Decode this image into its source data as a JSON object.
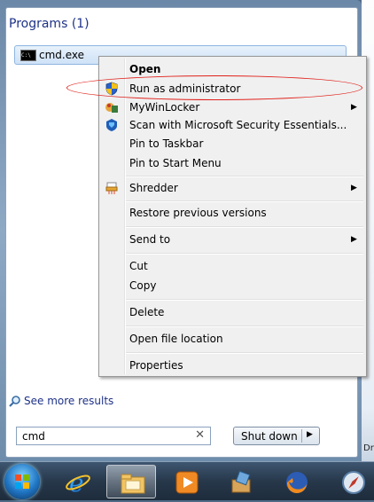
{
  "start_menu": {
    "programs_heading": "Programs (1)",
    "program_items": [
      {
        "label": "cmd.exe",
        "icon": "cmd-icon"
      }
    ],
    "see_more": "See more results",
    "search": {
      "value": "cmd"
    },
    "shutdown_label": "Shut down"
  },
  "context_menu": {
    "items": [
      {
        "label": "Open",
        "bold": true
      },
      {
        "label": "Run as administrator",
        "icon": "uac-shield-icon"
      },
      {
        "label": "MyWinLocker",
        "icon": "mywinlocker-icon",
        "submenu": true
      },
      {
        "label": "Scan with Microsoft Security Essentials...",
        "icon": "security-essentials-icon"
      },
      {
        "label": "Pin to Taskbar"
      },
      {
        "label": "Pin to Start Menu"
      },
      {
        "label": "Shredder",
        "icon": "shredder-icon",
        "submenu": true
      },
      {
        "label": "Restore previous versions"
      },
      {
        "label": "Send to",
        "submenu": true
      },
      {
        "label": "Cut"
      },
      {
        "label": "Copy"
      },
      {
        "label": "Delete"
      },
      {
        "label": "Open file location"
      },
      {
        "label": "Properties"
      }
    ],
    "highlighted_item": "Run as administrator",
    "highlight_color": "#e0211b"
  },
  "taskbar": {
    "buttons": [
      "start-orb",
      "internet-explorer-icon",
      "file-explorer-icon",
      "media-player-icon",
      "program-install-icon",
      "firefox-icon",
      "safari-icon"
    ],
    "active_button": "file-explorer-icon"
  },
  "desktop_partial_text": "Dra"
}
